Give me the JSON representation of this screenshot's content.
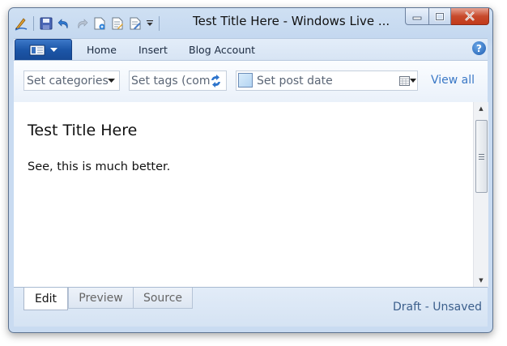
{
  "window": {
    "title": "Test Title Here - Windows Live ..."
  },
  "quick_access_toolbar": {
    "icons": [
      "writer-logo-icon",
      "save-icon",
      "undo-icon",
      "redo-icon",
      "new-post-icon",
      "open-post-icon",
      "edit-draft-icon",
      "customize-dropdown-icon"
    ]
  },
  "ribbon": {
    "tabs": [
      {
        "label": "Home"
      },
      {
        "label": "Insert"
      },
      {
        "label": "Blog Account"
      }
    ],
    "help_label": "?"
  },
  "post_properties": {
    "categories_placeholder": "Set categories",
    "tags_placeholder": "Set tags (com",
    "date_placeholder": "Set post date",
    "view_all_label": "View all"
  },
  "editor": {
    "title": "Test Title Here",
    "body": "See, this is much better."
  },
  "view_tabs": [
    {
      "label": "Edit",
      "active": true
    },
    {
      "label": "Preview",
      "active": false
    },
    {
      "label": "Source",
      "active": false
    }
  ],
  "status": {
    "text": "Draft - Unsaved"
  },
  "colors": {
    "accent": "#1c56a8",
    "link": "#3a78c6",
    "close_button": "#c74a2c"
  }
}
